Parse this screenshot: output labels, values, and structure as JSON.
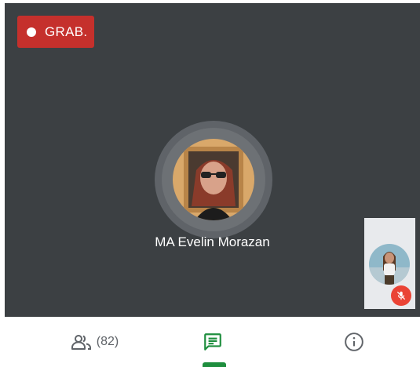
{
  "recording": {
    "label": "GRAB.",
    "color": "#c5302c"
  },
  "main_speaker": {
    "name": "MA Evelin Morazan",
    "avatar_icon": "user-photo"
  },
  "self_view": {
    "avatar_icon": "user-photo",
    "mic_status_icon": "mic-off-icon",
    "mic_muted": true
  },
  "bottom_tabs": {
    "people": {
      "icon": "people-icon",
      "count_label": "(82)"
    },
    "chat": {
      "icon": "chat-icon",
      "active": true
    },
    "info": {
      "icon": "info-icon"
    }
  },
  "colors": {
    "stage_background": "#3c4043",
    "accent": "#1e8e3e",
    "muted_red": "#ea4335"
  }
}
